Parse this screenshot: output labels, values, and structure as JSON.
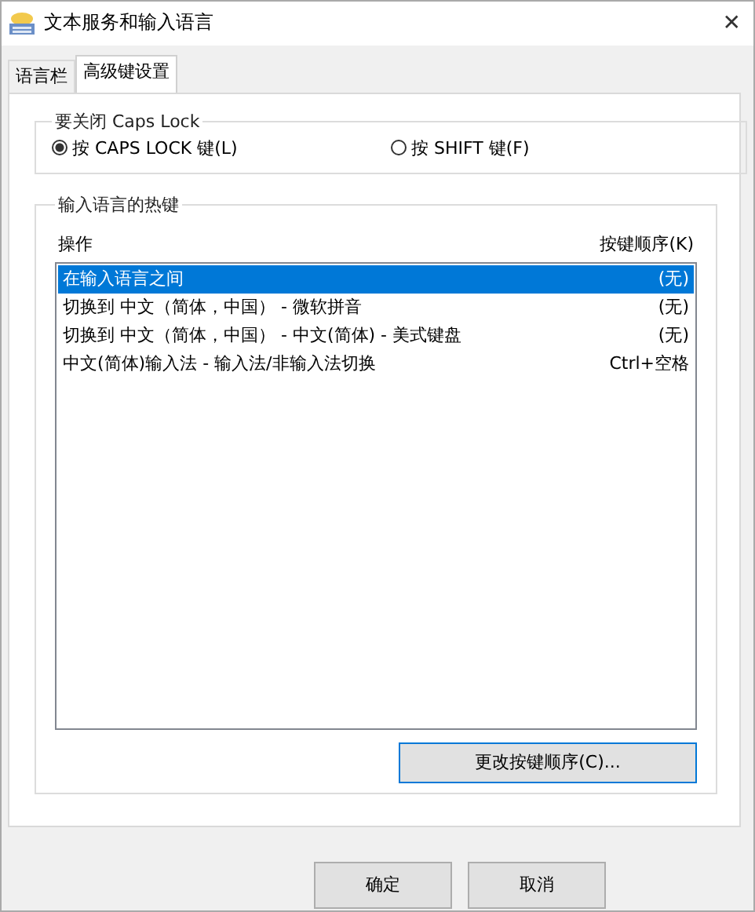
{
  "window": {
    "title": "文本服务和输入语言",
    "close": "✕"
  },
  "tabs": [
    {
      "label": "语言栏",
      "selected": false
    },
    {
      "label": "高级键设置",
      "selected": true
    }
  ],
  "caps_lock_group": {
    "title": "要关闭 Caps Lock",
    "options": [
      {
        "label": "按 CAPS LOCK 键(L)",
        "selected": true
      },
      {
        "label": "按 SHIFT 键(F)",
        "selected": false
      }
    ]
  },
  "hotkeys_group": {
    "title": "输入语言的热键",
    "columns": [
      "操作",
      "按键顺序(K)"
    ],
    "rows": [
      {
        "action": "在输入语言之间",
        "keys": "(无)",
        "selected": true
      },
      {
        "action": "切换到 中文（简体，中国） - 微软拼音",
        "keys": "(无)",
        "selected": false
      },
      {
        "action": "切换到 中文（简体，中国） - 中文(简体) - 美式键盘",
        "keys": "(无)",
        "selected": false
      },
      {
        "action": "中文(简体)输入法 - 输入法/非输入法切换",
        "keys": "Ctrl+空格",
        "selected": false
      }
    ],
    "button": "更改按键顺序(C)..."
  },
  "buttons": [
    "确定",
    "取消"
  ]
}
